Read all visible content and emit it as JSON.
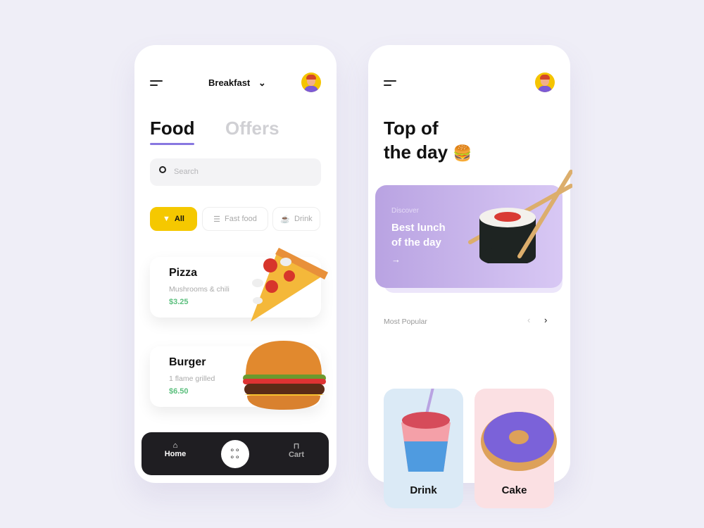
{
  "left": {
    "header": {
      "meal_select": "Breakfast"
    },
    "tabs": [
      {
        "label": "Food",
        "active": true
      },
      {
        "label": "Offers",
        "active": false
      }
    ],
    "search": {
      "placeholder": "Search"
    },
    "categories": [
      {
        "label": "All",
        "icon": "pizza-icon",
        "active": true
      },
      {
        "label": "Fast food",
        "icon": "burger-icon"
      },
      {
        "label": "Drink",
        "icon": "cup-icon"
      }
    ],
    "items": [
      {
        "name": "Pizza",
        "desc": "Mushrooms & chili",
        "price": "$3.25"
      },
      {
        "name": "Burger",
        "desc": "1 flame grilled",
        "price": "$6.50"
      }
    ],
    "nav": {
      "home": "Home",
      "cart": "Cart"
    }
  },
  "right": {
    "title_line1": "Top of",
    "title_line2": "the day",
    "title_emoji": "🍔",
    "banner": {
      "kicker": "Discover",
      "title_line1": "Best lunch",
      "title_line2": "of the day"
    },
    "section": "Most Popular",
    "popular": [
      {
        "label": "Drink",
        "color": "#dbeaf6"
      },
      {
        "label": "Cake",
        "color": "#fbe0e3"
      }
    ]
  },
  "colors": {
    "accent": "#8877e0",
    "chip_active": "#f5c800",
    "price": "#5bbf7d",
    "nav": "#1f1e22"
  }
}
